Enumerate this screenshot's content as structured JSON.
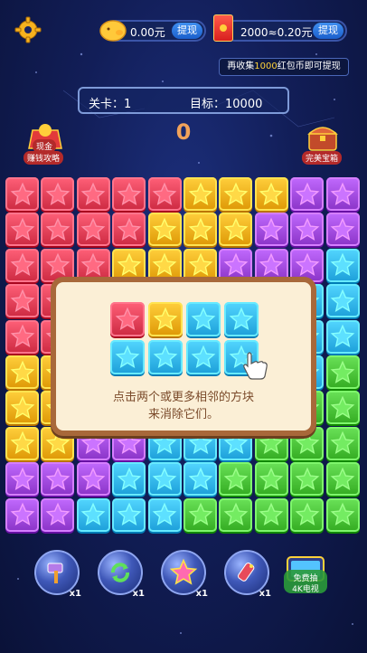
{
  "header": {
    "settings_icon": "gear-icon",
    "coin_balance": "0.00元",
    "coin_withdraw": "提现",
    "redpacket_balance": "2000≈0.20元",
    "redpacket_withdraw": "提现",
    "tip_prefix": "再收集",
    "tip_amount": "1000",
    "tip_suffix": "红包币即可提现"
  },
  "level": {
    "level_label": "关卡：1",
    "goal_label": "目标：10000",
    "score": "0"
  },
  "badges": {
    "left_label": "现金",
    "left_sub": "赚钱攻略",
    "right_label": "完美宝箱"
  },
  "colors": {
    "red": "#e5425a",
    "yellow": "#f7b11e",
    "purple": "#a34ce0",
    "blue": "#35b8f2",
    "green": "#4cc43a"
  },
  "board": {
    "rows": [
      [
        "red",
        "red",
        "red",
        "red",
        "red",
        "yellow",
        "yellow",
        "yellow",
        "purple",
        "purple"
      ],
      [
        "red",
        "red",
        "red",
        "red",
        "yellow",
        "yellow",
        "yellow",
        "purple",
        "purple",
        "purple"
      ],
      [
        "red",
        "red",
        "red",
        "yellow",
        "yellow",
        "yellow",
        "purple",
        "purple",
        "purple",
        "blue"
      ],
      [
        "red",
        "red",
        "red",
        "yellow",
        "yellow",
        "purple",
        "purple",
        "purple",
        "blue",
        "blue"
      ],
      [
        "red",
        "red",
        "red",
        "yellow",
        "purple",
        "purple",
        "purple",
        "blue",
        "blue",
        "blue"
      ],
      [
        "yellow",
        "yellow",
        "yellow",
        "yellow",
        "purple",
        "purple",
        "blue",
        "blue",
        "blue",
        "green"
      ],
      [
        "yellow",
        "yellow",
        "yellow",
        "purple",
        "purple",
        "blue",
        "blue",
        "green",
        "green",
        "green"
      ],
      [
        "yellow",
        "yellow",
        "purple",
        "purple",
        "blue",
        "blue",
        "blue",
        "green",
        "green",
        "green"
      ],
      [
        "purple",
        "purple",
        "purple",
        "blue",
        "blue",
        "blue",
        "green",
        "green",
        "green",
        "green"
      ],
      [
        "purple",
        "purple",
        "blue",
        "blue",
        "blue",
        "green",
        "green",
        "green",
        "green",
        "green"
      ]
    ]
  },
  "tutorial": {
    "row1": [
      "red",
      "yellow",
      "blue",
      "blue"
    ],
    "row2": [
      "blue",
      "blue",
      "blue",
      "blue"
    ],
    "line1": "点击两个或更多相邻的方块",
    "line2": "来消除它们。"
  },
  "tools": [
    {
      "name": "hammer-icon",
      "count": "x1"
    },
    {
      "name": "refresh-icon",
      "count": "x1"
    },
    {
      "name": "rainbow-star-icon",
      "count": "x1"
    },
    {
      "name": "rocket-icon",
      "count": "x1"
    }
  ],
  "ad_tool": {
    "line1": "免费抽",
    "line2": "4K电视"
  }
}
